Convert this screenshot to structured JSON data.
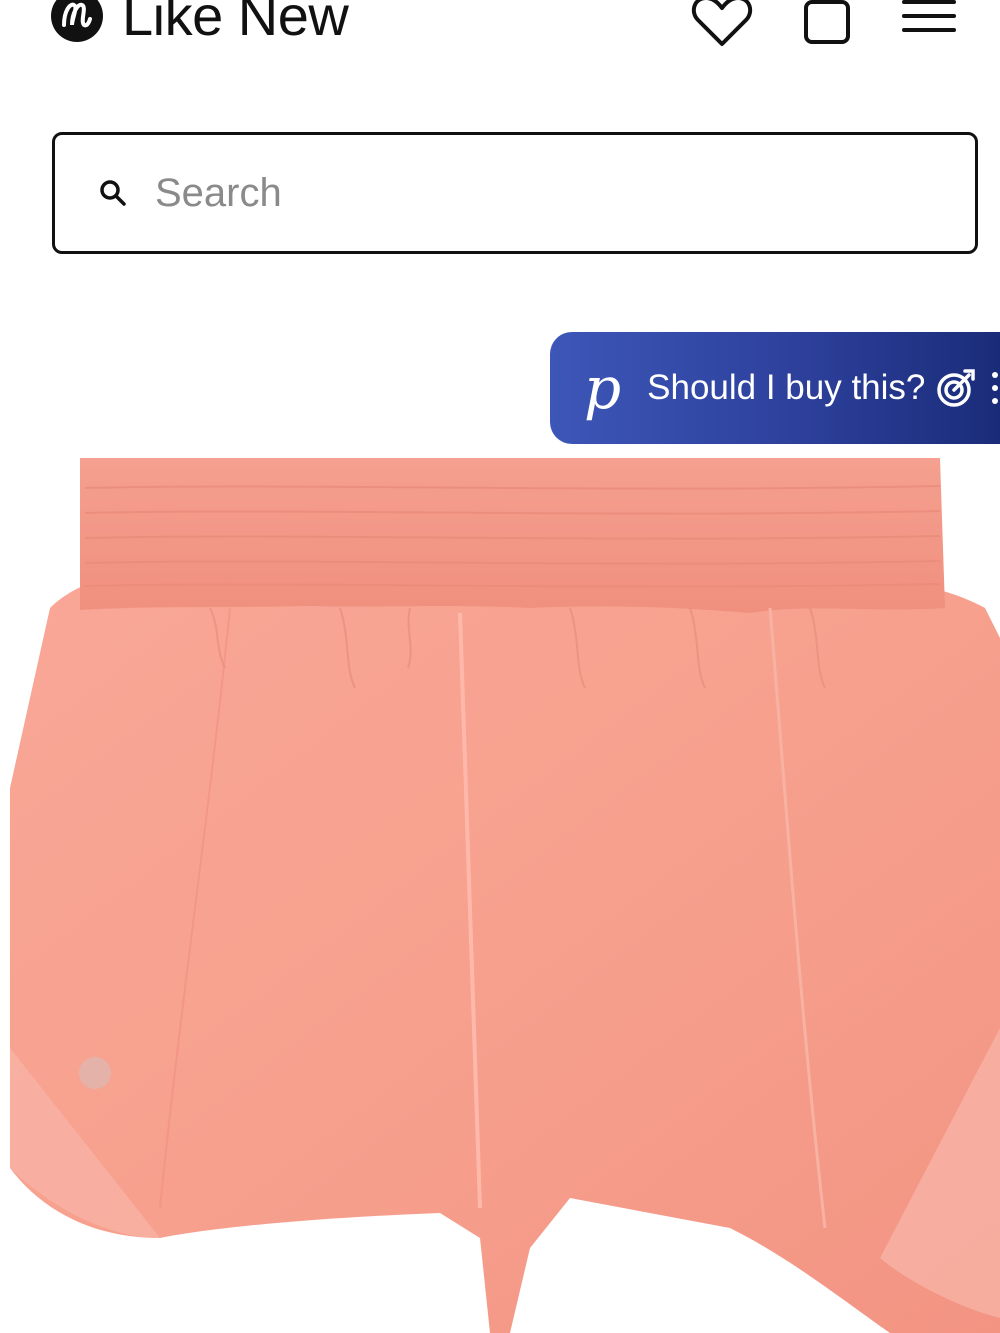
{
  "header": {
    "brand": "Like New",
    "icons": {
      "logo": "lululemon-logo-icon",
      "wishlist": "heart-icon",
      "cart": "shopping-bag-icon",
      "menu": "hamburger-menu-icon"
    }
  },
  "search": {
    "placeholder": "Search",
    "icon": "search-icon"
  },
  "assistant": {
    "logo": "p",
    "label": "Should I buy this?",
    "icons": {
      "action": "target-icon",
      "more": "more-vertical-icon"
    },
    "colors": {
      "start": "#3d57b8",
      "end": "#182a75"
    }
  },
  "product": {
    "image": "coral pink running shorts",
    "color": "#f7a08e"
  }
}
